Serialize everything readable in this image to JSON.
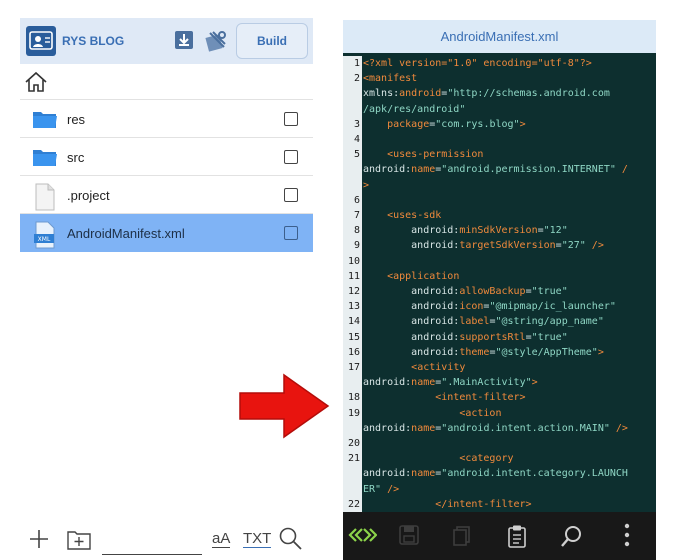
{
  "left": {
    "app_title": "RYS BLOG",
    "build_label": "Build",
    "files": [
      {
        "name": "res",
        "type": "folder",
        "selected": false
      },
      {
        "name": "src",
        "type": "folder",
        "selected": false
      },
      {
        "name": ".project",
        "type": "file",
        "selected": false
      },
      {
        "name": "AndroidManifest.xml",
        "type": "xml",
        "selected": true
      }
    ],
    "bottom": {
      "font_size_label": "aA",
      "txt_label": "TXT"
    }
  },
  "editor": {
    "title": "AndroidManifest.xml",
    "lines": [
      {
        "n": "1",
        "segs": [
          [
            "decl",
            "<?xml version=\"1.0\" encoding=\"utf-8\"?>"
          ]
        ]
      },
      {
        "n": "2",
        "segs": [
          [
            "tag",
            "<manifest"
          ]
        ]
      },
      {
        "n": "",
        "segs": [
          [
            "plain",
            "xmlns:"
          ],
          [
            "attr",
            "android"
          ],
          [
            "plain",
            "="
          ],
          [
            "val",
            "\"http://schemas.android.com"
          ]
        ]
      },
      {
        "n": "",
        "segs": [
          [
            "val",
            "/apk/res/android\""
          ]
        ]
      },
      {
        "n": "3",
        "segs": [
          [
            "plain",
            "    "
          ],
          [
            "attr",
            "package"
          ],
          [
            "plain",
            "="
          ],
          [
            "val",
            "\"com.rys.blog\""
          ],
          [
            "tag",
            ">"
          ]
        ]
      },
      {
        "n": "4",
        "segs": []
      },
      {
        "n": "5",
        "segs": [
          [
            "plain",
            "    "
          ],
          [
            "tag",
            "<uses-permission"
          ]
        ]
      },
      {
        "n": "",
        "segs": [
          [
            "plain",
            "android:"
          ],
          [
            "attr",
            "name"
          ],
          [
            "plain",
            "="
          ],
          [
            "val",
            "\"android.permission.INTERNET\""
          ],
          [
            "tag",
            " /"
          ]
        ]
      },
      {
        "n": "",
        "segs": [
          [
            "tag",
            ">"
          ]
        ]
      },
      {
        "n": "6",
        "segs": []
      },
      {
        "n": "7",
        "segs": [
          [
            "plain",
            "    "
          ],
          [
            "tag",
            "<uses-sdk"
          ]
        ]
      },
      {
        "n": "8",
        "segs": [
          [
            "plain",
            "        android:"
          ],
          [
            "attr",
            "minSdkVersion"
          ],
          [
            "plain",
            "="
          ],
          [
            "val",
            "\"12\""
          ]
        ]
      },
      {
        "n": "9",
        "segs": [
          [
            "plain",
            "        android:"
          ],
          [
            "attr",
            "targetSdkVersion"
          ],
          [
            "plain",
            "="
          ],
          [
            "val",
            "\"27\""
          ],
          [
            "tag",
            " />"
          ]
        ]
      },
      {
        "n": "10",
        "segs": []
      },
      {
        "n": "11",
        "segs": [
          [
            "plain",
            "    "
          ],
          [
            "tag",
            "<application"
          ]
        ]
      },
      {
        "n": "12",
        "segs": [
          [
            "plain",
            "        android:"
          ],
          [
            "attr",
            "allowBackup"
          ],
          [
            "plain",
            "="
          ],
          [
            "val",
            "\"true\""
          ]
        ]
      },
      {
        "n": "13",
        "segs": [
          [
            "plain",
            "        android:"
          ],
          [
            "attr",
            "icon"
          ],
          [
            "plain",
            "="
          ],
          [
            "val",
            "\"@mipmap/ic_launcher\""
          ]
        ]
      },
      {
        "n": "14",
        "segs": [
          [
            "plain",
            "        android:"
          ],
          [
            "attr",
            "label"
          ],
          [
            "plain",
            "="
          ],
          [
            "val",
            "\"@string/app_name\""
          ]
        ]
      },
      {
        "n": "15",
        "segs": [
          [
            "plain",
            "        android:"
          ],
          [
            "attr",
            "supportsRtl"
          ],
          [
            "plain",
            "="
          ],
          [
            "val",
            "\"true\""
          ]
        ]
      },
      {
        "n": "16",
        "segs": [
          [
            "plain",
            "        android:"
          ],
          [
            "attr",
            "theme"
          ],
          [
            "plain",
            "="
          ],
          [
            "val",
            "\"@style/AppTheme\""
          ],
          [
            "tag",
            ">"
          ]
        ]
      },
      {
        "n": "17",
        "segs": [
          [
            "plain",
            "        "
          ],
          [
            "tag",
            "<activity"
          ]
        ]
      },
      {
        "n": "",
        "segs": [
          [
            "plain",
            "android:"
          ],
          [
            "attr",
            "name"
          ],
          [
            "plain",
            "="
          ],
          [
            "val",
            "\".MainActivity\""
          ],
          [
            "tag",
            ">"
          ]
        ]
      },
      {
        "n": "18",
        "segs": [
          [
            "plain",
            "            "
          ],
          [
            "tag",
            "<intent-filter>"
          ]
        ]
      },
      {
        "n": "19",
        "segs": [
          [
            "plain",
            "                "
          ],
          [
            "tag",
            "<action"
          ]
        ]
      },
      {
        "n": "",
        "segs": [
          [
            "plain",
            "android:"
          ],
          [
            "attr",
            "name"
          ],
          [
            "plain",
            "="
          ],
          [
            "val",
            "\"android.intent.action.MAIN\""
          ],
          [
            "tag",
            " />"
          ]
        ]
      },
      {
        "n": "20",
        "segs": []
      },
      {
        "n": "21",
        "segs": [
          [
            "plain",
            "                "
          ],
          [
            "tag",
            "<category"
          ]
        ]
      },
      {
        "n": "",
        "segs": [
          [
            "plain",
            "android:"
          ],
          [
            "attr",
            "name"
          ],
          [
            "plain",
            "="
          ],
          [
            "val",
            "\"android.intent.category.LAUNCH"
          ]
        ]
      },
      {
        "n": "",
        "segs": [
          [
            "val",
            "ER\""
          ],
          [
            "tag",
            " />"
          ]
        ]
      },
      {
        "n": "22",
        "segs": [
          [
            "plain",
            "            "
          ],
          [
            "tag",
            "</intent-filter>"
          ]
        ]
      }
    ]
  },
  "colors": {
    "accent": "#3a6fb4",
    "selection": "#7fb3f5",
    "editor_bg": "#0d2f2f",
    "xml_tag": "#f08a3c",
    "xml_value": "#8fd7c5",
    "arrow": "#e8140f"
  }
}
